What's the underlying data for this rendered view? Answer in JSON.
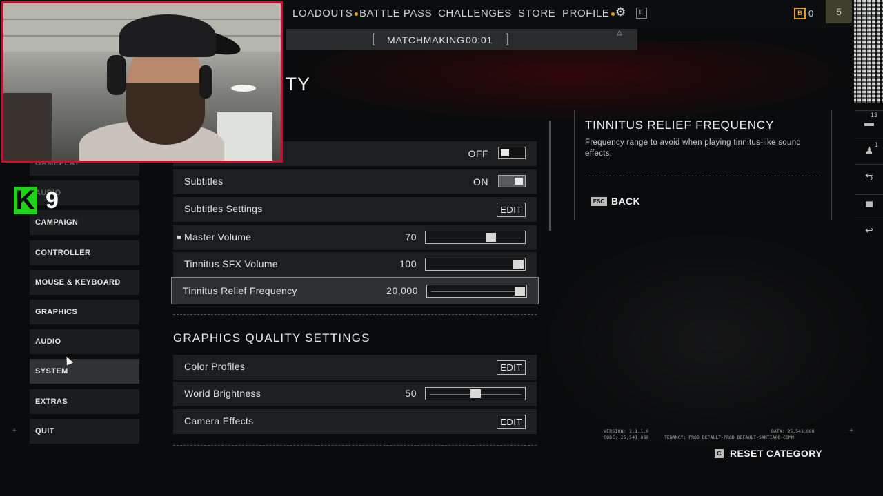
{
  "nav": {
    "items": [
      {
        "label": "LOADOUTS",
        "dot": true
      },
      {
        "label": "BATTLE PASS",
        "dot": false
      },
      {
        "label": "CHALLENGES",
        "dot": false
      },
      {
        "label": "STORE",
        "dot": false
      },
      {
        "label": "PROFILE",
        "dot": true
      }
    ],
    "gear_icon": "gear-icon",
    "e_key": "E",
    "currency_icon": "B",
    "currency_value": "0",
    "rank_value": "5"
  },
  "matchmaking": {
    "label": "MATCHMAKING",
    "time": "00:01"
  },
  "page_title": "ITY",
  "sidebar": {
    "items": [
      {
        "label": "GAMEPLAY"
      },
      {
        "label": "AUDIO"
      },
      {
        "label": "CAMPAIGN"
      },
      {
        "label": "CONTROLLER"
      },
      {
        "label": "MOUSE & KEYBOARD"
      },
      {
        "label": "GRAPHICS"
      },
      {
        "label": "AUDIO"
      },
      {
        "label": "SYSTEM"
      },
      {
        "label": "EXTRAS"
      },
      {
        "label": "QUIT"
      }
    ]
  },
  "settings": {
    "rows": [
      {
        "label": "",
        "type": "toggle",
        "state": "OFF"
      },
      {
        "label": "Subtitles",
        "type": "toggle",
        "state": "ON"
      },
      {
        "label": "Subtitles Settings",
        "type": "edit",
        "button": "EDIT"
      },
      {
        "label": "Master Volume",
        "type": "slider",
        "value": "70",
        "fill": 0.68
      },
      {
        "label": "Tinnitus SFX Volume",
        "type": "slider",
        "value": "100",
        "fill": 1.0
      },
      {
        "label": "Tinnitus Relief Frequency",
        "type": "slider",
        "value": "20,000",
        "fill": 1.0
      }
    ],
    "graphics_section_title": "GRAPHICS QUALITY SETTINGS",
    "graphics_rows": [
      {
        "label": "Color Profiles",
        "type": "edit",
        "button": "EDIT"
      },
      {
        "label": "World Brightness",
        "type": "slider",
        "value": "50",
        "fill": 0.5
      },
      {
        "label": "Camera Effects",
        "type": "edit",
        "button": "EDIT"
      }
    ]
  },
  "description": {
    "title": "TINNITUS RELIEF FREQUENCY",
    "text": "Frequency range to avoid when playing tinnitus-like sound effects.",
    "esc_key": "ESC",
    "back_label": "BACK"
  },
  "right_rail": {
    "count_1": "13",
    "count_2": "1"
  },
  "footer": {
    "version": "VERSION: 1.1.1.0",
    "code": "CODE: 25,541,068",
    "data": "DATA: 25,541,068",
    "tenancy": "TENANCY: PROD_DEFAULT-PROD_DEFAULT-SANTIAGO-COMM",
    "reset_key": "C",
    "reset_label": "RESET CATEGORY"
  },
  "overlay": {
    "k_letter": "K",
    "nine": "9"
  }
}
